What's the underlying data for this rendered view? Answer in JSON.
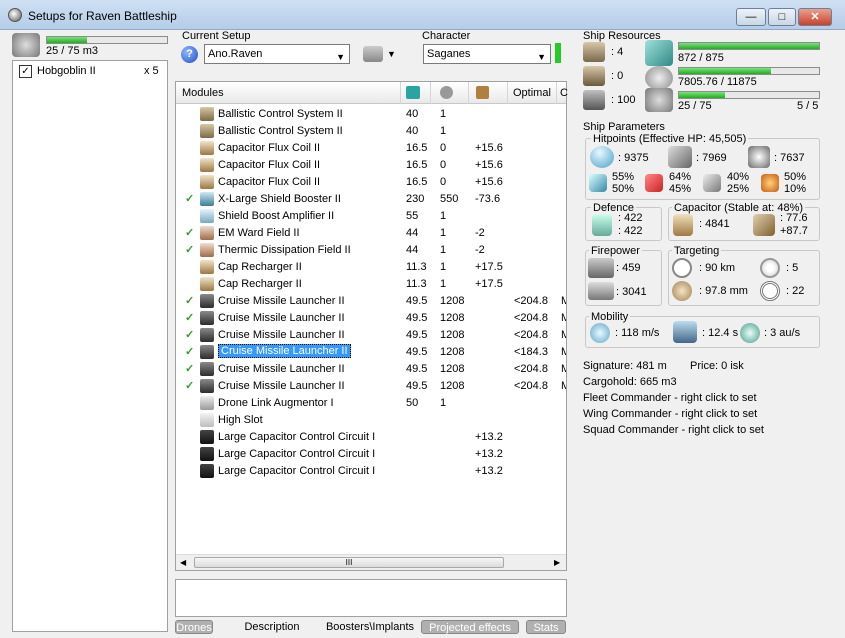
{
  "window": {
    "title": "Setups for Raven Battleship",
    "minimize": "—",
    "maximize": "□",
    "close": "✕"
  },
  "drone_bay": {
    "capacity": "25 / 75 m3",
    "capacity_fraction": 0.33,
    "items": [
      {
        "name": "Hobgoblin II",
        "count": "x 5",
        "checked": true
      }
    ]
  },
  "setup": {
    "label": "Current Setup",
    "value": "Ano.Raven"
  },
  "character": {
    "label": "Character",
    "value": "Saganes"
  },
  "modules": {
    "headers": {
      "name": "Modules",
      "optimal": "Optimal",
      "extra": "C"
    },
    "rows": [
      {
        "name": "Ballistic Control System II",
        "cpu": "40",
        "pg": "1",
        "cap": "",
        "optimal": "",
        "checked": false,
        "icon": "ballistic-icon",
        "selected": false
      },
      {
        "name": "Ballistic Control System II",
        "cpu": "40",
        "pg": "1",
        "cap": "",
        "optimal": "",
        "checked": false,
        "icon": "ballistic-icon",
        "selected": false
      },
      {
        "name": "Capacitor Flux Coil II",
        "cpu": "16.5",
        "pg": "0",
        "cap": "+15.6",
        "optimal": "",
        "checked": false,
        "icon": "capacitor-icon",
        "selected": false
      },
      {
        "name": "Capacitor Flux Coil II",
        "cpu": "16.5",
        "pg": "0",
        "cap": "+15.6",
        "optimal": "",
        "checked": false,
        "icon": "capacitor-icon",
        "selected": false
      },
      {
        "name": "Capacitor Flux Coil II",
        "cpu": "16.5",
        "pg": "0",
        "cap": "+15.6",
        "optimal": "",
        "checked": false,
        "icon": "capacitor-icon",
        "selected": false
      },
      {
        "name": "X-Large Shield Booster II",
        "cpu": "230",
        "pg": "550",
        "cap": "-73.6",
        "optimal": "",
        "checked": true,
        "icon": "shield-booster-icon",
        "selected": false
      },
      {
        "name": "Shield Boost Amplifier II",
        "cpu": "55",
        "pg": "1",
        "cap": "",
        "optimal": "",
        "checked": false,
        "icon": "shield-amp-icon",
        "selected": false
      },
      {
        "name": "EM Ward Field II",
        "cpu": "44",
        "pg": "1",
        "cap": "-2",
        "optimal": "",
        "checked": true,
        "icon": "ward-field-icon",
        "selected": false
      },
      {
        "name": "Thermic Dissipation Field II",
        "cpu": "44",
        "pg": "1",
        "cap": "-2",
        "optimal": "",
        "checked": true,
        "icon": "ward-field-icon",
        "selected": false
      },
      {
        "name": "Cap Recharger II",
        "cpu": "11.3",
        "pg": "1",
        "cap": "+17.5",
        "optimal": "",
        "checked": false,
        "icon": "capacitor-icon",
        "selected": false
      },
      {
        "name": "Cap Recharger II",
        "cpu": "11.3",
        "pg": "1",
        "cap": "+17.5",
        "optimal": "",
        "checked": false,
        "icon": "capacitor-icon",
        "selected": false
      },
      {
        "name": "Cruise Missile Launcher II",
        "cpu": "49.5",
        "pg": "1208",
        "cap": "",
        "optimal": "<204.8",
        "checked": true,
        "icon": "launcher-icon",
        "selected": false
      },
      {
        "name": "Cruise Missile Launcher II",
        "cpu": "49.5",
        "pg": "1208",
        "cap": "",
        "optimal": "<204.8",
        "checked": true,
        "icon": "launcher-icon",
        "selected": false
      },
      {
        "name": "Cruise Missile Launcher II",
        "cpu": "49.5",
        "pg": "1208",
        "cap": "",
        "optimal": "<204.8",
        "checked": true,
        "icon": "launcher-icon",
        "selected": false
      },
      {
        "name": "Cruise Missile Launcher II",
        "cpu": "49.5",
        "pg": "1208",
        "cap": "",
        "optimal": "<184.3",
        "checked": true,
        "icon": "launcher-icon",
        "selected": true
      },
      {
        "name": "Cruise Missile Launcher II",
        "cpu": "49.5",
        "pg": "1208",
        "cap": "",
        "optimal": "<204.8",
        "checked": true,
        "icon": "launcher-icon",
        "selected": false
      },
      {
        "name": "Cruise Missile Launcher II",
        "cpu": "49.5",
        "pg": "1208",
        "cap": "",
        "optimal": "<204.8",
        "checked": true,
        "icon": "launcher-icon",
        "selected": false
      },
      {
        "name": "Drone Link Augmentor I",
        "cpu": "50",
        "pg": "1",
        "cap": "",
        "optimal": "",
        "checked": false,
        "icon": "drone-link-icon",
        "selected": false
      },
      {
        "name": "High Slot",
        "cpu": "",
        "pg": "",
        "cap": "",
        "optimal": "",
        "checked": false,
        "icon": "empty-slot-icon",
        "selected": false
      },
      {
        "name": "Large Capacitor Control Circuit I",
        "cpu": "",
        "pg": "",
        "cap": "+13.2",
        "optimal": "",
        "checked": false,
        "icon": "rig-icon",
        "selected": false
      },
      {
        "name": "Large Capacitor Control Circuit I",
        "cpu": "",
        "pg": "",
        "cap": "+13.2",
        "optimal": "",
        "checked": false,
        "icon": "rig-icon",
        "selected": false
      },
      {
        "name": "Large Capacitor Control Circuit I",
        "cpu": "",
        "pg": "",
        "cap": "+13.2",
        "optimal": "",
        "checked": false,
        "icon": "rig-icon",
        "selected": false
      }
    ],
    "row_extra": "M",
    "scroll_grip": "III"
  },
  "bottom_tabs": [
    "Drones",
    "Description",
    "Boosters\\Implants",
    "Projected effects",
    "Stats"
  ],
  "ship_resources": {
    "label": "Ship Resources",
    "turrets": ": 4",
    "launchers": ": 0",
    "calibration": ": 100",
    "cpu": "872 / 875",
    "cpu_fraction": 0.997,
    "powergrid": "7805.76 / 11875",
    "powergrid_fraction": 0.657,
    "drone_bw": "25 / 75",
    "drone_bw_fraction": 0.33,
    "drones_active": "5 / 5"
  },
  "ship_parameters": {
    "label": "Ship Parameters",
    "hitpoints": {
      "label": "Hitpoints (Effective HP: 45,505)",
      "shield": ": 9375",
      "armor": ": 7969",
      "structure": ": 7637"
    },
    "resists": [
      {
        "top": "55%",
        "bottom": "50%"
      },
      {
        "top": "64%",
        "bottom": "45%"
      },
      {
        "top": "40%",
        "bottom": "25%"
      },
      {
        "top": "50%",
        "bottom": "10%"
      }
    ],
    "defence": {
      "label": "Defence",
      "a": ": 422",
      "b": ": 422"
    },
    "capacitor": {
      "label": "Capacitor (Stable at: 48%)",
      "amount": ": 4841",
      "delta_a": ": 77.6",
      "delta_b": "+87.7"
    },
    "firepower": {
      "label": "Firepower",
      "volley": ": 459",
      "dps": ": 3041"
    },
    "targeting": {
      "label": "Targeting",
      "range": ": 90 km",
      "targets": ": 5",
      "scan": ": 97.8 mm",
      "sig": ": 22"
    },
    "mobility": {
      "label": "Mobility",
      "speed": ": 118 m/s",
      "align": ": 12.4 s",
      "warp": ": 3 au/s"
    }
  },
  "ship_info": {
    "signature": "Signature: 481 m",
    "price": "Price: 0 isk",
    "cargohold": "Cargohold: 665 m3",
    "fleet": "Fleet Commander - right click to set",
    "wing": "Wing Commander - right click to set",
    "squad": "Squad Commander - right click to set"
  }
}
